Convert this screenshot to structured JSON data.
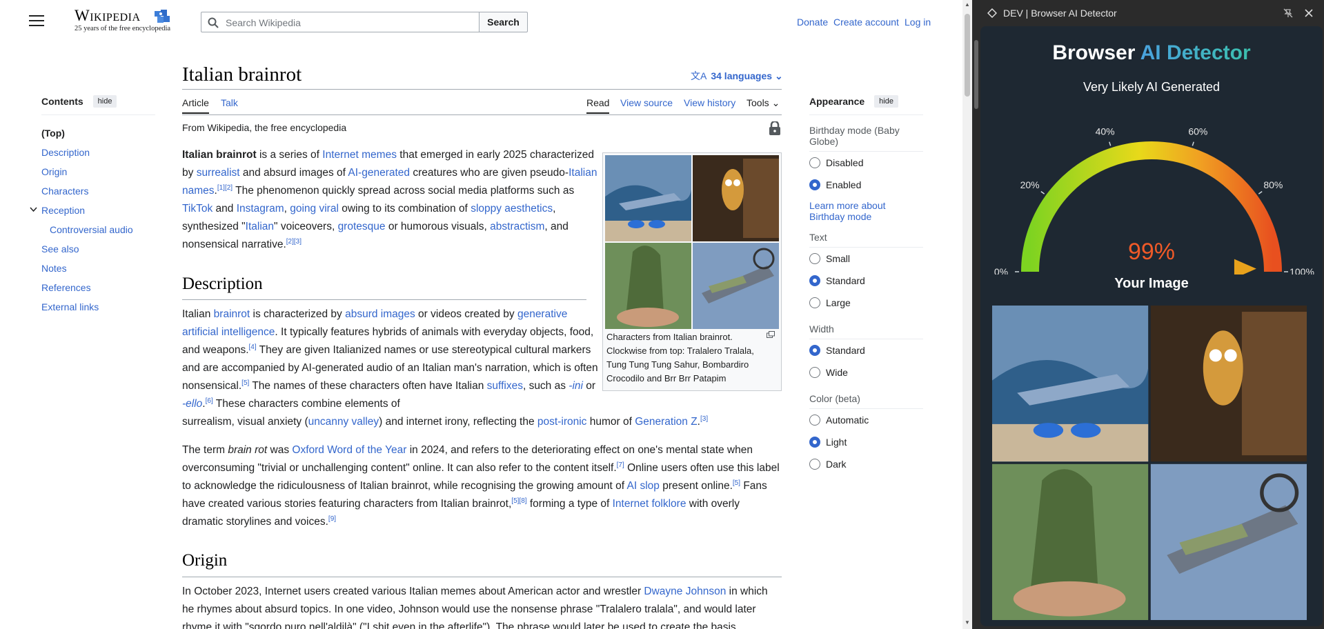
{
  "wikipedia": {
    "logo": {
      "wordmark": "Wikipedia",
      "tagline": "25 years of the free encyclopedia"
    },
    "search": {
      "placeholder": "Search Wikipedia",
      "button": "Search"
    },
    "user_links": {
      "donate": "Donate",
      "create_account": "Create account",
      "log_in": "Log in"
    },
    "toc": {
      "title": "Contents",
      "hide": "hide",
      "items": [
        "(Top)",
        "Description",
        "Origin",
        "Characters",
        "Reception",
        "Controversial audio",
        "See also",
        "Notes",
        "References",
        "External links"
      ]
    },
    "page": {
      "title": "Italian brainrot",
      "languages": "34 languages",
      "tabs": {
        "article": "Article",
        "talk": "Talk",
        "read": "Read",
        "view_source": "View source",
        "view_history": "View history",
        "tools": "Tools"
      },
      "from": "From Wikipedia, the free encyclopedia",
      "caption": "Characters from Italian brainrot. Clockwise from top: Tralalero Tralala, Tung Tung Tung Sahur, Bombardiro Crocodilo and Brr Brr Patapim",
      "section_description": "Description",
      "section_origin": "Origin"
    },
    "appearance": {
      "title": "Appearance",
      "hide": "hide",
      "birthday_mode": {
        "label": "Birthday mode (Baby Globe)",
        "options": [
          "Disabled",
          "Enabled"
        ],
        "selected": "Enabled",
        "learn_more": "Learn more about Birthday mode"
      },
      "text": {
        "label": "Text",
        "options": [
          "Small",
          "Standard",
          "Large"
        ],
        "selected": "Standard"
      },
      "width": {
        "label": "Width",
        "options": [
          "Standard",
          "Wide"
        ],
        "selected": "Standard"
      },
      "color": {
        "label": "Color (beta)",
        "options": [
          "Automatic",
          "Light",
          "Dark"
        ],
        "selected": "Light"
      }
    }
  },
  "extension": {
    "window_title": "DEV | Browser AI Detector",
    "title_part1": "Browser ",
    "title_part2": "AI Detector",
    "verdict": "Very Likely AI Generated",
    "gauge": {
      "value": 99,
      "display": "99%",
      "ticks": [
        "0%",
        "20%",
        "40%",
        "60%",
        "80%",
        "100%"
      ]
    },
    "your_image": "Your Image",
    "colors": {
      "accent_blue": "#4aa3df",
      "accent_teal": "#3bbfad",
      "value": "#f05a28",
      "background": "#1e2832"
    }
  }
}
